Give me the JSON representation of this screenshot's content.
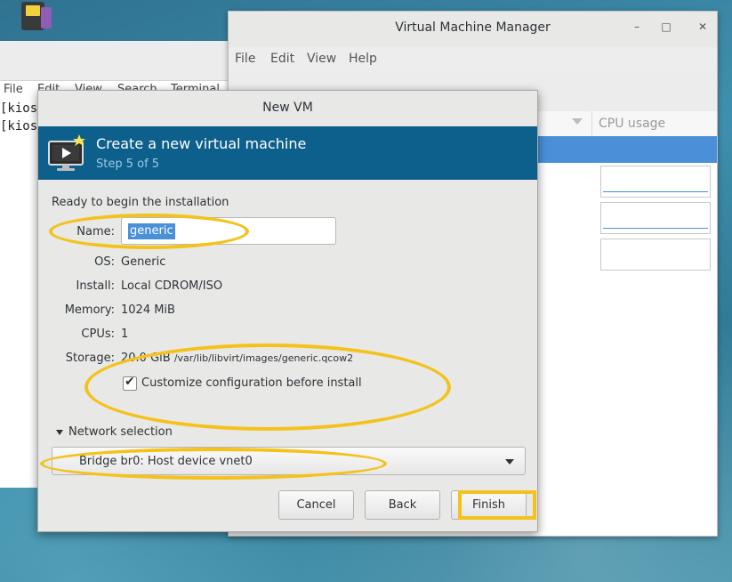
{
  "terminal": {
    "menu": [
      "File",
      "Edit",
      "View",
      "Search",
      "Terminal"
    ],
    "lines": [
      "[kios",
      "[kios"
    ]
  },
  "vmm": {
    "title": "Virtual Machine Manager",
    "menu": [
      "File",
      "Edit",
      "View",
      "Help"
    ],
    "toolbar": [
      "new-vm-icon",
      "open-icon",
      "run-icon",
      "pause-icon",
      "shutdown-icon"
    ],
    "cpu_header": "CPU usage",
    "window_controls": [
      "minimize-icon",
      "maximize-icon",
      "close-icon"
    ]
  },
  "dialog": {
    "title": "New VM",
    "banner_title": "Create a new virtual machine",
    "banner_step": "Step 5 of 5",
    "ready": "Ready to begin the installation",
    "name_label": "Name:",
    "name_value": "generic",
    "os_label": "OS:",
    "os_value": "Generic",
    "install_label": "Install:",
    "install_value": "Local CDROM/ISO",
    "memory_label": "Memory:",
    "memory_value": "1024 MiB",
    "cpus_label": "CPUs:",
    "cpus_value": "1",
    "storage_label": "Storage:",
    "storage_size": "20.0 GiB",
    "storage_path": "/var/lib/libvirt/images/generic.qcow2",
    "customize_label": "Customize configuration before install",
    "customize_checked": true,
    "network_section": "Network selection",
    "network_value": "Bridge br0: Host device vnet0",
    "cancel": "Cancel",
    "back": "Back",
    "finish": "Finish"
  },
  "colors": {
    "banner": "#0d5f8c",
    "selection": "#4a90d9",
    "highlight": "#f4c21b"
  }
}
